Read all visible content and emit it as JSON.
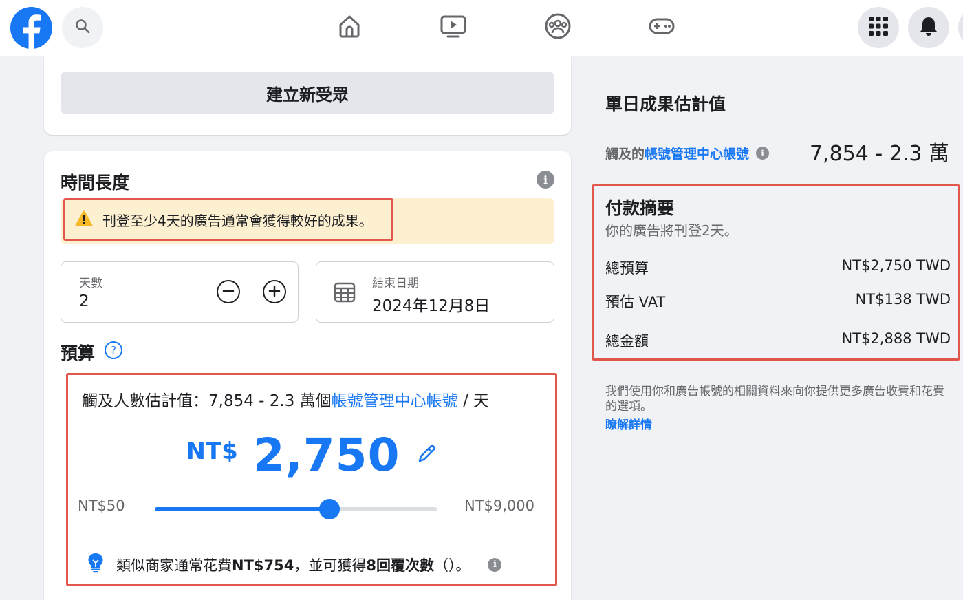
{
  "colors": {
    "accent": "#1877f2",
    "highlight": "#e2574c",
    "warning_bg": "#fcf0d1"
  },
  "topbar": {
    "icons": [
      "facebook-logo",
      "search-icon",
      "home-icon",
      "watch-icon",
      "groups-icon",
      "gaming-icon",
      "menu-grid-icon",
      "bell-icon"
    ]
  },
  "audience": {
    "create_label": "建立新受眾"
  },
  "duration": {
    "title": "時間長度",
    "warning": "刊登至少4天的廣告通常會獲得較好的成果。",
    "days_label": "天數",
    "days_value": "2",
    "end_date_label": "結束日期",
    "end_date_value": "2024年12月8日"
  },
  "budget": {
    "title": "預算",
    "help_glyph": "?",
    "reach_prefix": "觸及人數估計值：7,854 - 2.3 萬個",
    "reach_link": "帳號管理中心帳號",
    "reach_suffix": " / 天",
    "currency": "NT$",
    "amount": "2,750",
    "min_label": "NT$50",
    "max_label": "NT$9,000",
    "slider_fraction": 0.62,
    "tip_prefix": "類似商家通常花費",
    "tip_amount": "NT$754",
    "tip_mid": "，並可獲得",
    "tip_freq": "8回覆次數",
    "tip_suffix": "（）。"
  },
  "estimate": {
    "title": "單日成果估計值",
    "reach_prefix": "觸及的",
    "reach_link": "帳號管理中心帳號",
    "reach_value": "7,854 - 2.3 萬"
  },
  "payment": {
    "title": "付款摘要",
    "subtitle": "你的廣告將刊登2天。",
    "rows": [
      {
        "label": "總預算",
        "value": "NT$2,750 TWD"
      },
      {
        "label": "預估 VAT",
        "value": "NT$138 TWD"
      }
    ],
    "total_label": "總金額",
    "total_value": "NT$2,888 TWD"
  },
  "footnote": {
    "text": "我們使用你和廣告帳號的相關資料來向你提供更多廣告收費和花費的選項。",
    "link": "瞭解詳情"
  }
}
